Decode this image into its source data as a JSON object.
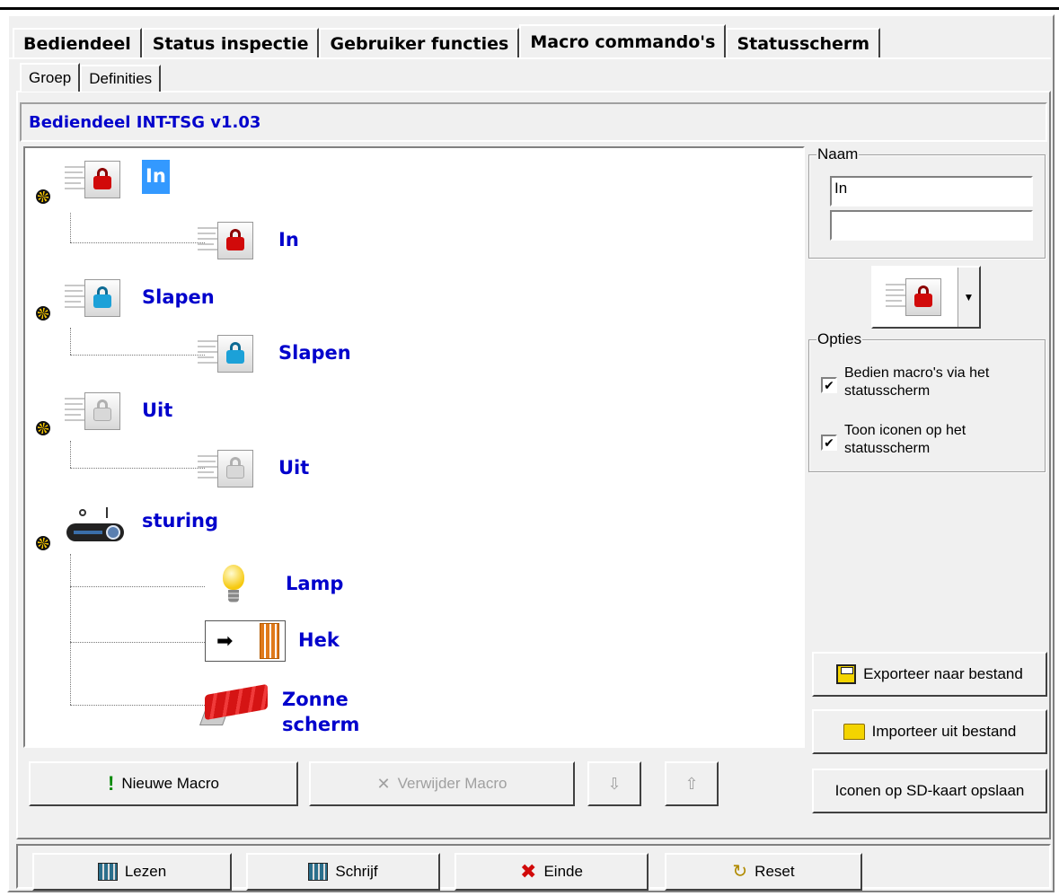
{
  "tabs": [
    "Bediendeel",
    "Status inspectie",
    "Gebruiker functies",
    "Macro commando's",
    "Statusscherm"
  ],
  "active_tab": "Macro commando's",
  "subtabs": [
    "Groep",
    "Definities"
  ],
  "active_subtab": "Groep",
  "header_title": "Bediendeel INT-TSG v1.03",
  "tree": {
    "groups": [
      {
        "label": "In",
        "icon": "lock-red-icon",
        "selected": true,
        "children": [
          {
            "label": "In",
            "icon": "lock-red-icon"
          }
        ]
      },
      {
        "label": "Slapen",
        "icon": "lock-blue-icon",
        "children": [
          {
            "label": "Slapen",
            "icon": "lock-blue-icon"
          }
        ]
      },
      {
        "label": "Uit",
        "icon": "lock-grey-icon",
        "children": [
          {
            "label": "Uit",
            "icon": "lock-grey-icon"
          }
        ]
      },
      {
        "label": "sturing",
        "icon": "switch-icon",
        "children": [
          {
            "label": "Lamp",
            "icon": "bulb-icon"
          },
          {
            "label": "Hek",
            "icon": "gate-icon"
          },
          {
            "label": "Zonne scherm",
            "label_line1": "Zonne",
            "label_line2": "scherm",
            "icon": "awning-icon"
          }
        ]
      }
    ]
  },
  "naam": {
    "title": "Naam",
    "value1": "In",
    "value2": ""
  },
  "opties": {
    "title": "Opties",
    "items": [
      {
        "label_line1": "Bedien macro's via het",
        "label_line2": "statusscherm",
        "checked": true
      },
      {
        "label_line1": "Toon iconen op het",
        "label_line2": "statusscherm",
        "checked": true
      }
    ]
  },
  "buttons": {
    "new_macro": "Nieuwe Macro",
    "delete_macro": "Verwijder Macro",
    "export": "Exporteer naar bestand",
    "import": "Importeer uit bestand",
    "save_icons": "Iconen op SD-kaart opslaan",
    "read": "Lezen",
    "write": "Schrijf",
    "end": "Einde",
    "reset": "Reset"
  },
  "checkmark": "✔",
  "arrow_down": "⇩",
  "arrow_up": "⇧"
}
